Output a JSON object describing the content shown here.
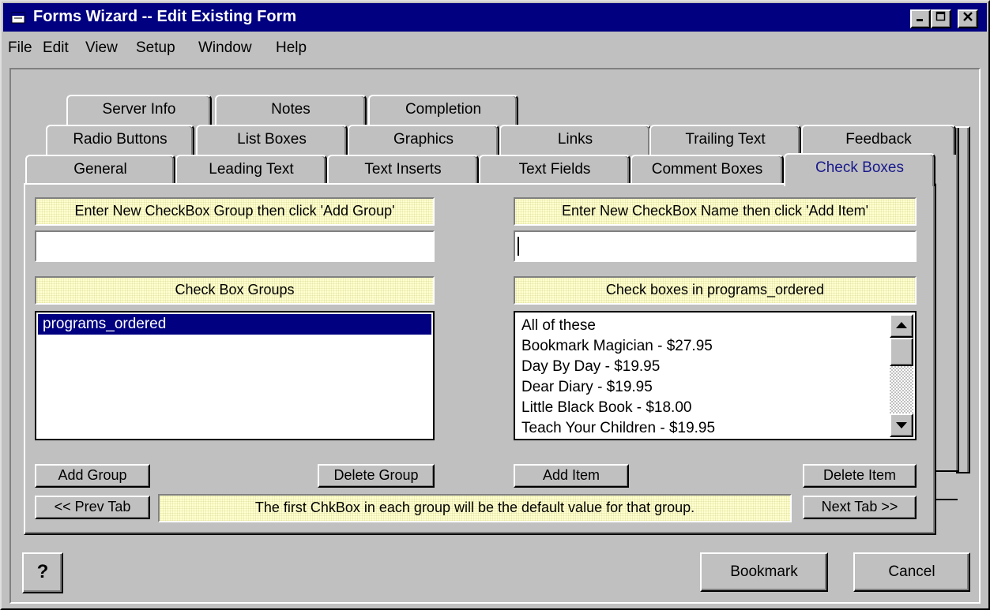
{
  "window": {
    "title": "Forms Wizard -- Edit Existing Form"
  },
  "menu": [
    "File",
    "Edit",
    "View",
    "Setup",
    "Window",
    "Help"
  ],
  "tabs": {
    "row1": [
      "Server Info",
      "Notes",
      "Completion"
    ],
    "row2": [
      "Radio Buttons",
      "List Boxes",
      "Graphics",
      "Links",
      "Trailing Text",
      "Feedback"
    ],
    "row3": [
      "General",
      "Leading Text",
      "Text Inserts",
      "Text Fields",
      "Comment Boxes",
      "Check Boxes"
    ],
    "active": "Check Boxes"
  },
  "left": {
    "prompt": "Enter New CheckBox Group then click 'Add Group'",
    "input_value": "",
    "list_label": "Check Box Groups",
    "groups": [
      "programs_ordered"
    ],
    "add_button": "Add Group",
    "delete_button": "Delete Group"
  },
  "right": {
    "prompt": "Enter New CheckBox Name then click 'Add Item'",
    "input_value": "",
    "list_label": "Check boxes in programs_ordered",
    "items": [
      "All of these",
      "Bookmark Magician - $27.95",
      "Day By Day - $19.95",
      "Dear Diary - $19.95",
      "Little Black Book - $18.00",
      "Teach Your Children - $19.95"
    ],
    "add_button": "Add Item",
    "delete_button": "Delete Item"
  },
  "nav": {
    "prev": "<< Prev Tab",
    "next": "Next Tab >>",
    "hint": "The first ChkBox in each group will be the default value for that group."
  },
  "footer": {
    "help_glyph": "?",
    "bookmark": "Bookmark",
    "cancel": "Cancel"
  }
}
